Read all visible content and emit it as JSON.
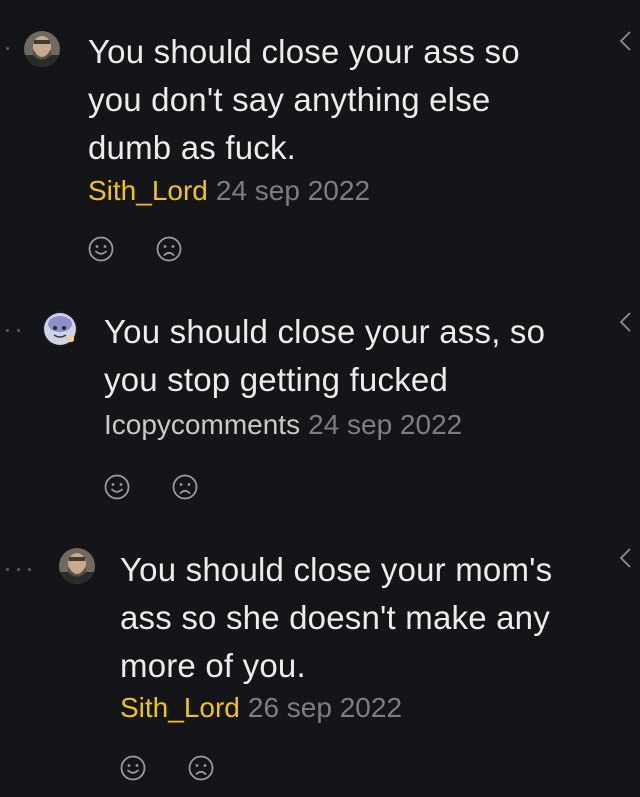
{
  "comments": [
    {
      "text": "You should close your ass so you don't say anything else dumb as fuck.",
      "author": "Sith_Lord",
      "date": "24 sep 2022",
      "author_color": "#f2c21b",
      "avatar": "bearded-man-avatar",
      "reactions": [
        "smiley-face-icon",
        "sad-face-icon"
      ]
    },
    {
      "text": "You should close your ass, so you stop getting fucked",
      "author": "Icopycomments",
      "date": "24 sep 2022",
      "author_color": "#c9c9c9",
      "avatar": "cartoon-character-avatar",
      "reactions": [
        "smiley-face-icon",
        "sad-face-icon"
      ]
    },
    {
      "text": "You should close your mom's ass so she doesn't make any more of you.",
      "author": "Sith_Lord",
      "date": "26 sep 2022",
      "author_color": "#f2c21b",
      "avatar": "bearded-man-avatar",
      "reactions": [
        "smiley-face-icon",
        "sad-face-icon"
      ]
    }
  ],
  "colors": {
    "background": "#141519",
    "text": "#ececec",
    "date": "#7d7e82",
    "icon": "#9a9ba0"
  }
}
